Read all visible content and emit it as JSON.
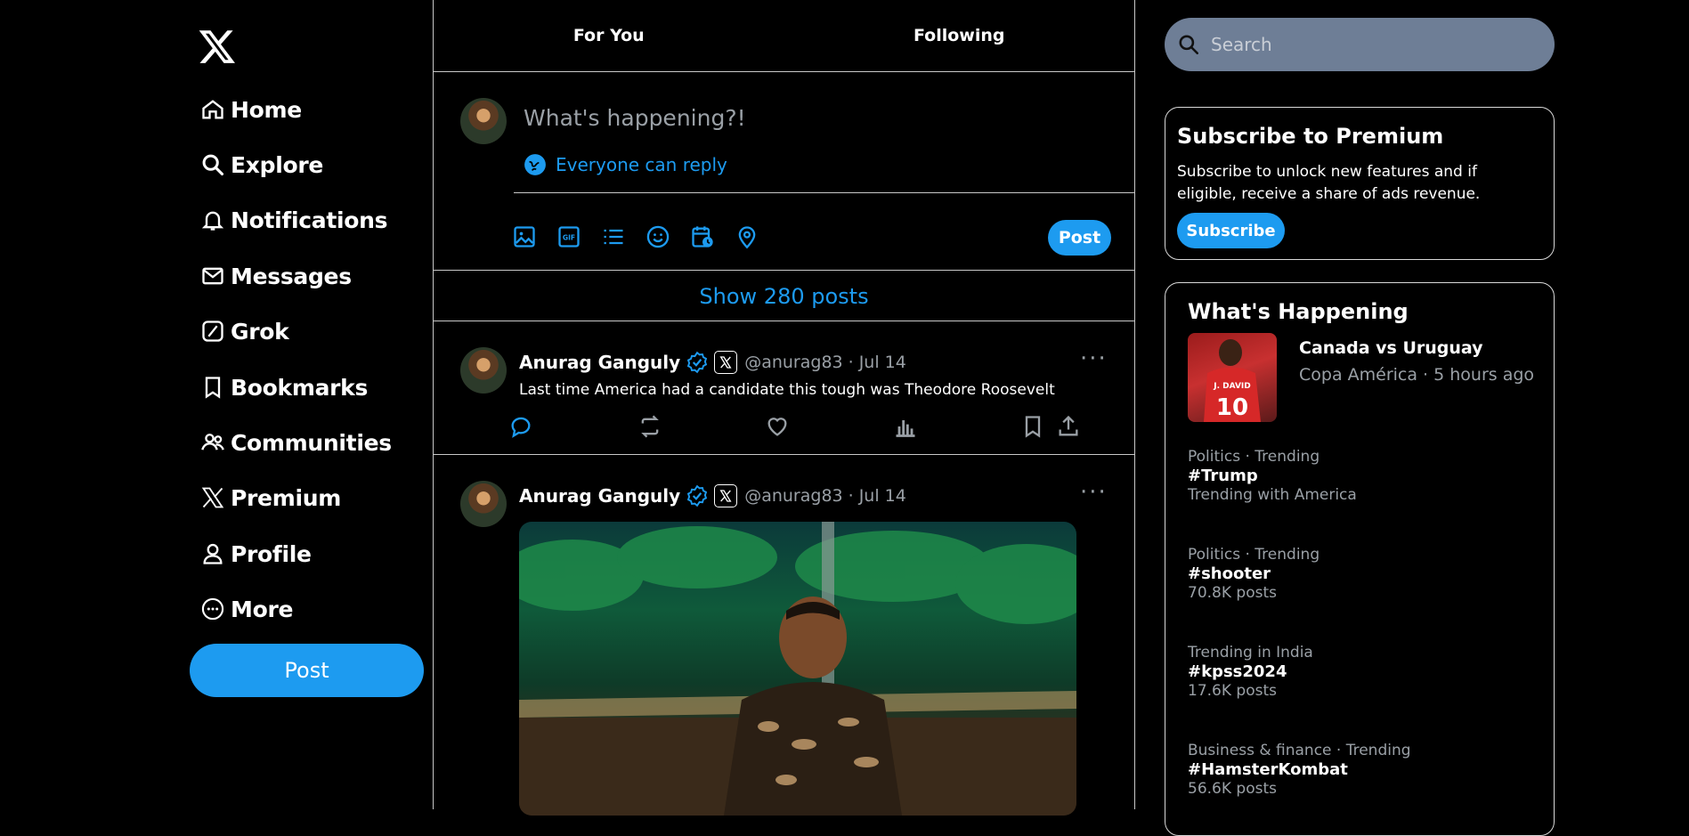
{
  "sidebar": {
    "items": [
      {
        "label": "Home",
        "icon": "home-icon"
      },
      {
        "label": "Explore",
        "icon": "search-icon"
      },
      {
        "label": "Notifications",
        "icon": "bell-icon"
      },
      {
        "label": "Messages",
        "icon": "envelope-icon"
      },
      {
        "label": "Grok",
        "icon": "grok-icon"
      },
      {
        "label": "Bookmarks",
        "icon": "bookmark-icon"
      },
      {
        "label": "Communities",
        "icon": "people-icon"
      },
      {
        "label": "Premium",
        "icon": "x-logo-icon"
      },
      {
        "label": "Profile",
        "icon": "person-icon"
      },
      {
        "label": "More",
        "icon": "more-circle-icon"
      }
    ],
    "post_label": "Post"
  },
  "tabs": [
    "For You",
    "Following"
  ],
  "compose": {
    "placeholder": "What's happening?!",
    "reply_setting": "Everyone can reply",
    "post_label": "Post",
    "tools": [
      "image-icon",
      "gif-icon",
      "poll-icon",
      "emoji-icon",
      "schedule-icon",
      "location-icon"
    ]
  },
  "feed": {
    "show_posts": "Show 280 posts",
    "posts": [
      {
        "name": "Anurag Ganguly",
        "handle": "@anurag83",
        "date": "· Jul 14",
        "text": "Last time America had a candidate this tough was Theodore Roosevelt"
      },
      {
        "name": "Anurag Ganguly",
        "handle": "@anurag83",
        "date": "· Jul 14"
      }
    ]
  },
  "search": {
    "placeholder": "Search"
  },
  "premium": {
    "title": "Subscribe to Premium",
    "description": "Subscribe to unlock new features and if eligible, receive a share of ads revenue.",
    "button": "Subscribe"
  },
  "whats_happening": {
    "title": "What's Happening",
    "featured": {
      "title": "Canada vs Uruguay",
      "meta": "Copa América · 5 hours ago"
    },
    "trends": [
      {
        "category": "Politics · Trending",
        "name": "#Trump",
        "count": "Trending with America"
      },
      {
        "category": "Politics · Trending",
        "name": "#shooter",
        "count": "70.8K posts"
      },
      {
        "category": "Trending in India",
        "name": "#kpss2024",
        "count": "17.6K posts"
      },
      {
        "category": "Business & finance · Trending",
        "name": "#HamsterKombat",
        "count": "56.6K posts"
      }
    ]
  },
  "colors": {
    "accent": "#1d9bf0",
    "background": "#000000",
    "border": "#c8c8c8",
    "muted": "#9aa0a6"
  }
}
